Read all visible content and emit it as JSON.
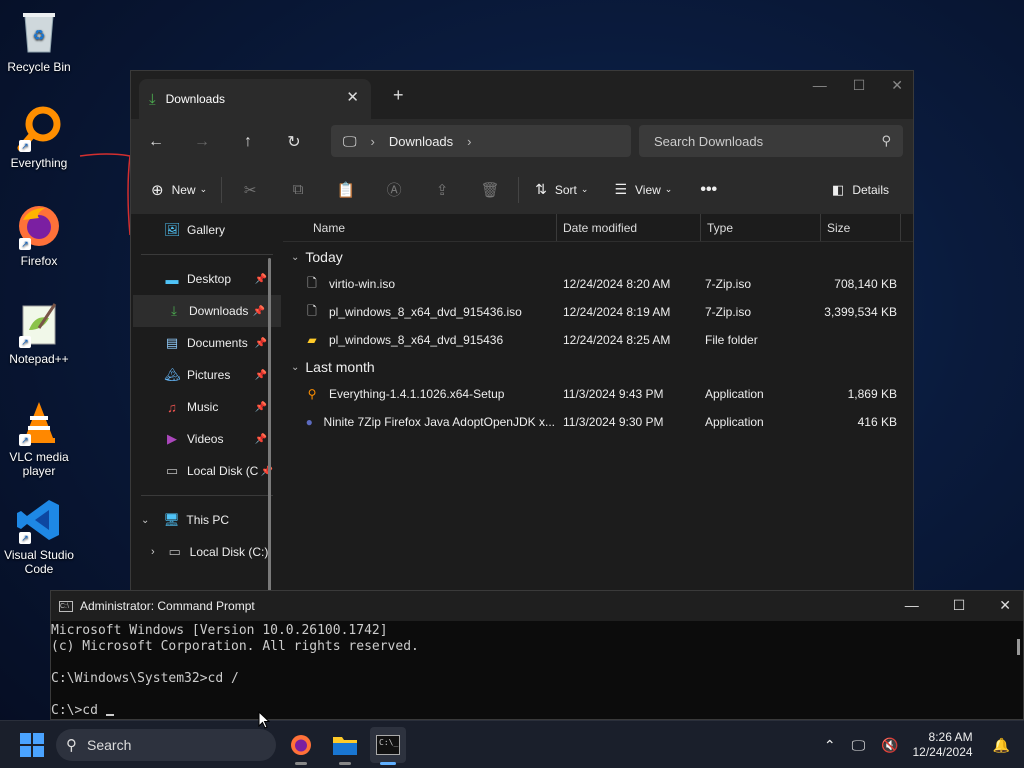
{
  "desktop": {
    "icons": [
      {
        "label": "Recycle Bin"
      },
      {
        "label": "Everything"
      },
      {
        "label": "Firefox"
      },
      {
        "label": "Notepad++"
      },
      {
        "label": "VLC media player"
      },
      {
        "label": "Visual Studio Code"
      }
    ]
  },
  "explorer": {
    "tab_title": "Downloads",
    "address": {
      "segment": "Downloads"
    },
    "search_placeholder": "Search Downloads",
    "toolbar": {
      "new": "New",
      "sort": "Sort",
      "view": "View",
      "details": "Details"
    },
    "sidebar": {
      "items": [
        {
          "label": "Gallery"
        },
        {
          "label": "Desktop"
        },
        {
          "label": "Downloads"
        },
        {
          "label": "Documents"
        },
        {
          "label": "Pictures"
        },
        {
          "label": "Music"
        },
        {
          "label": "Videos"
        },
        {
          "label": "Local Disk (C"
        },
        {
          "label": "This PC"
        },
        {
          "label": "Local Disk (C:)"
        }
      ]
    },
    "columns": {
      "name": "Name",
      "date": "Date modified",
      "type": "Type",
      "size": "Size"
    },
    "groups": [
      {
        "title": "Today",
        "files": [
          {
            "name": "virtio-win.iso",
            "date": "12/24/2024 8:20 AM",
            "type": "7-Zip.iso",
            "size": "708,140 KB"
          },
          {
            "name": "pl_windows_8_x64_dvd_915436.iso",
            "date": "12/24/2024 8:19 AM",
            "type": "7-Zip.iso",
            "size": "3,399,534 KB"
          },
          {
            "name": "pl_windows_8_x64_dvd_915436",
            "date": "12/24/2024 8:25 AM",
            "type": "File folder",
            "size": ""
          }
        ]
      },
      {
        "title": "Last month",
        "files": [
          {
            "name": "Everything-1.4.1.1026.x64-Setup",
            "date": "11/3/2024 9:43 PM",
            "type": "Application",
            "size": "1,869 KB"
          },
          {
            "name": "Ninite 7Zip Firefox Java AdoptOpenJDK x...",
            "date": "11/3/2024 9:30 PM",
            "type": "Application",
            "size": "416 KB"
          }
        ]
      }
    ]
  },
  "cmd": {
    "title": "Administrator: Command Prompt",
    "lines": [
      "Microsoft Windows [Version 10.0.26100.1742]",
      "(c) Microsoft Corporation. All rights reserved.",
      "",
      "C:\\Windows\\System32>cd /",
      "",
      "C:\\>cd "
    ]
  },
  "taskbar": {
    "search_label": "Search",
    "time": "8:26 AM",
    "date": "12/24/2024"
  }
}
